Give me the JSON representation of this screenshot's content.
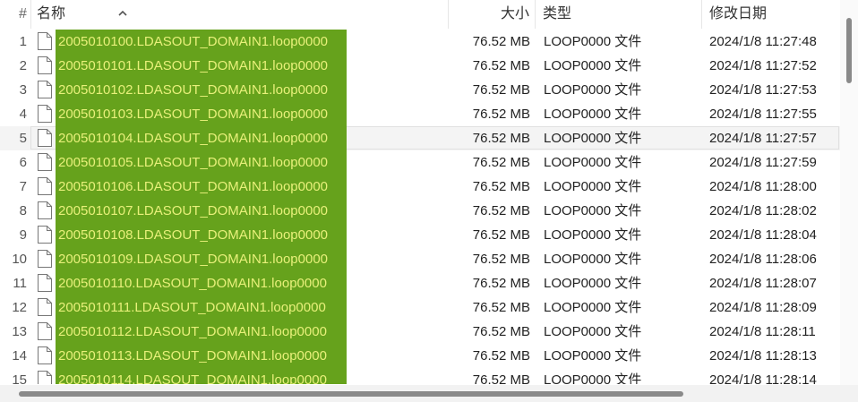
{
  "header": {
    "index_label": "#",
    "name_label": "名称",
    "size_label": "大小",
    "type_label": "类型",
    "date_label": "修改日期",
    "sort_icon": "chevron-up-icon"
  },
  "files": [
    {
      "index": "1",
      "name": "2005010100.LDASOUT_DOMAIN1.loop0000",
      "size": "76.52 MB",
      "type": "LOOP0000 文件",
      "date": "2024/1/8 11:27:48"
    },
    {
      "index": "2",
      "name": "2005010101.LDASOUT_DOMAIN1.loop0000",
      "size": "76.52 MB",
      "type": "LOOP0000 文件",
      "date": "2024/1/8 11:27:52"
    },
    {
      "index": "3",
      "name": "2005010102.LDASOUT_DOMAIN1.loop0000",
      "size": "76.52 MB",
      "type": "LOOP0000 文件",
      "date": "2024/1/8 11:27:53"
    },
    {
      "index": "4",
      "name": "2005010103.LDASOUT_DOMAIN1.loop0000",
      "size": "76.52 MB",
      "type": "LOOP0000 文件",
      "date": "2024/1/8 11:27:55"
    },
    {
      "index": "5",
      "name": "2005010104.LDASOUT_DOMAIN1.loop0000",
      "size": "76.52 MB",
      "type": "LOOP0000 文件",
      "date": "2024/1/8 11:27:57"
    },
    {
      "index": "6",
      "name": "2005010105.LDASOUT_DOMAIN1.loop0000",
      "size": "76.52 MB",
      "type": "LOOP0000 文件",
      "date": "2024/1/8 11:27:59"
    },
    {
      "index": "7",
      "name": "2005010106.LDASOUT_DOMAIN1.loop0000",
      "size": "76.52 MB",
      "type": "LOOP0000 文件",
      "date": "2024/1/8 11:28:00"
    },
    {
      "index": "8",
      "name": "2005010107.LDASOUT_DOMAIN1.loop0000",
      "size": "76.52 MB",
      "type": "LOOP0000 文件",
      "date": "2024/1/8 11:28:02"
    },
    {
      "index": "9",
      "name": "2005010108.LDASOUT_DOMAIN1.loop0000",
      "size": "76.52 MB",
      "type": "LOOP0000 文件",
      "date": "2024/1/8 11:28:04"
    },
    {
      "index": "10",
      "name": "2005010109.LDASOUT_DOMAIN1.loop0000",
      "size": "76.52 MB",
      "type": "LOOP0000 文件",
      "date": "2024/1/8 11:28:06"
    },
    {
      "index": "11",
      "name": "2005010110.LDASOUT_DOMAIN1.loop0000",
      "size": "76.52 MB",
      "type": "LOOP0000 文件",
      "date": "2024/1/8 11:28:07"
    },
    {
      "index": "12",
      "name": "2005010111.LDASOUT_DOMAIN1.loop0000",
      "size": "76.52 MB",
      "type": "LOOP0000 文件",
      "date": "2024/1/8 11:28:09"
    },
    {
      "index": "13",
      "name": "2005010112.LDASOUT_DOMAIN1.loop0000",
      "size": "76.52 MB",
      "type": "LOOP0000 文件",
      "date": "2024/1/8 11:28:11"
    },
    {
      "index": "14",
      "name": "2005010113.LDASOUT_DOMAIN1.loop0000",
      "size": "76.52 MB",
      "type": "LOOP0000 文件",
      "date": "2024/1/8 11:28:13"
    },
    {
      "index": "15",
      "name": "2005010114.LDASOUT_DOMAIN1.loop0000",
      "size": "76.52 MB",
      "type": "LOOP0000 文件",
      "date": "2024/1/8 11:28:14"
    }
  ],
  "colors": {
    "selection": "#66a21c",
    "selection_text": "#e8f07a",
    "hover_row": "#f4f4f4"
  },
  "file_icon": "document-icon"
}
